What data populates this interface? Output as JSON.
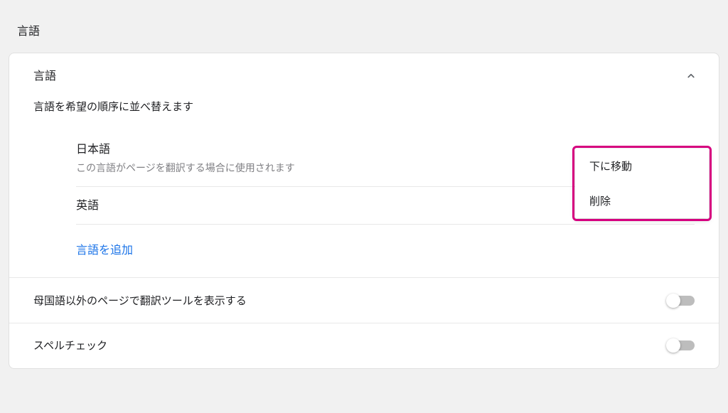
{
  "pageTitle": "言語",
  "languagesSection": {
    "header": "言語",
    "description": "言語を希望の順序に並べ替えます",
    "items": [
      {
        "name": "日本語",
        "sub": "この言語がページを翻訳する場合に使用されます"
      },
      {
        "name": "英語",
        "sub": ""
      }
    ],
    "addLanguage": "言語を追加"
  },
  "popup": {
    "moveDown": "下に移動",
    "delete": "削除"
  },
  "translateRow": {
    "label": "母国語以外のページで翻訳ツールを表示する"
  },
  "spellCheckRow": {
    "label": "スペルチェック"
  }
}
